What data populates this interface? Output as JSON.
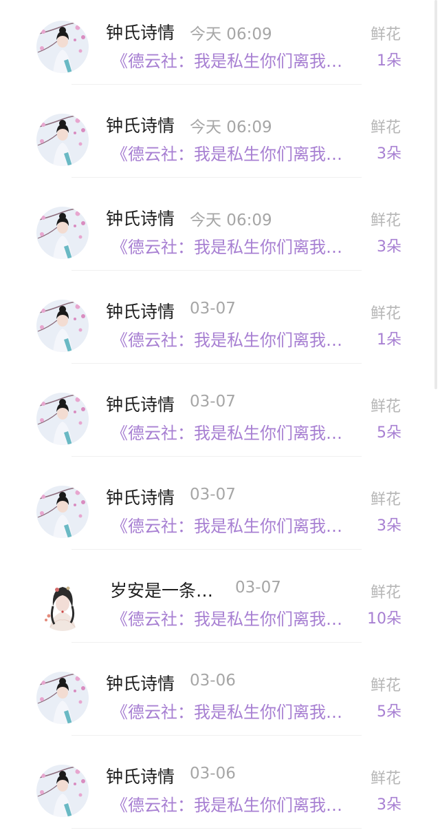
{
  "items": [
    {
      "name": "钟氏诗情",
      "time": "今天 06:09",
      "preview": "《德云社：我是私生你们离我…",
      "flower_label": "鲜花",
      "count": "1朵",
      "avatar": "plum-blossom-girl-avatar"
    },
    {
      "name": "钟氏诗情",
      "time": "今天 06:09",
      "preview": "《德云社：我是私生你们离我…",
      "flower_label": "鲜花",
      "count": "3朵",
      "avatar": "plum-blossom-girl-avatar"
    },
    {
      "name": "钟氏诗情",
      "time": "今天 06:09",
      "preview": "《德云社：我是私生你们离我…",
      "flower_label": "鲜花",
      "count": "3朵",
      "avatar": "plum-blossom-girl-avatar"
    },
    {
      "name": "钟氏诗情",
      "time": "03-07",
      "preview": "《德云社：我是私生你们离我…",
      "flower_label": "鲜花",
      "count": "1朵",
      "avatar": "plum-blossom-girl-avatar"
    },
    {
      "name": "钟氏诗情",
      "time": "03-07",
      "preview": "《德云社：我是私生你们离我…",
      "flower_label": "鲜花",
      "count": "5朵",
      "avatar": "plum-blossom-girl-avatar"
    },
    {
      "name": "钟氏诗情",
      "time": "03-07",
      "preview": "《德云社：我是私生你们离我…",
      "flower_label": "鲜花",
      "count": "3朵",
      "avatar": "plum-blossom-girl-avatar"
    },
    {
      "name": "岁安是一条…",
      "time": "03-07",
      "preview": "《德云社：我是私生你们离我…",
      "flower_label": "鲜花",
      "count": "10朵",
      "avatar": "ancient-costume-lady-avatar"
    },
    {
      "name": "钟氏诗情",
      "time": "03-06",
      "preview": "《德云社：我是私生你们离我…",
      "flower_label": "鲜花",
      "count": "5朵",
      "avatar": "plum-blossom-girl-avatar"
    },
    {
      "name": "钟氏诗情",
      "time": "03-06",
      "preview": "《德云社：我是私生你们离我…",
      "flower_label": "鲜花",
      "count": "3朵",
      "avatar": "plum-blossom-girl-avatar"
    }
  ],
  "colors": {
    "name": "#1e1e1e",
    "time": "#a6a6a6",
    "accent": "#a77fd2",
    "flower_label": "#b6b6b6"
  }
}
